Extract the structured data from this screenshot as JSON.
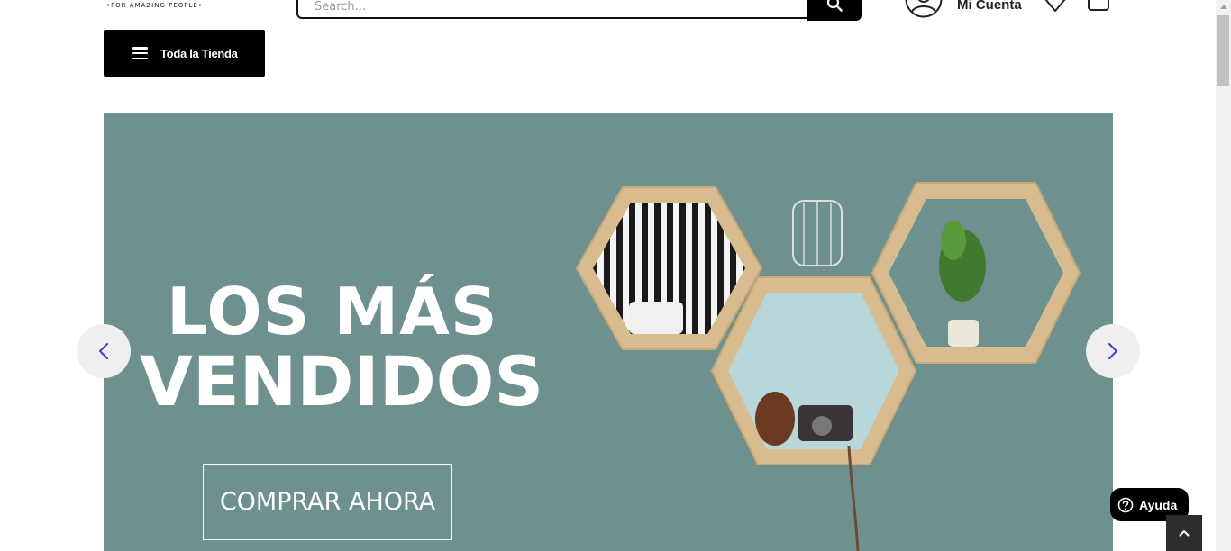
{
  "header": {
    "tagline": "•FOR AMAZING PEOPLE•",
    "search": {
      "placeholder": "Search..."
    },
    "account_label": "Mi Cuenta"
  },
  "categories_button": {
    "label": "Toda la Tienda"
  },
  "hero": {
    "headline_line1": "LOS MÁS",
    "headline_line2": "VENDIDOS",
    "cta_label": "COMPRAR AHORA",
    "background_color": "#6e9190"
  },
  "help_button": {
    "label": "Ayuda"
  },
  "icons": {
    "search": "search-icon",
    "account": "user-icon",
    "wishlist": "heart-icon",
    "cart": "cart-icon",
    "menu": "menu-icon",
    "prev": "chevron-left-icon",
    "next": "chevron-right-icon",
    "help": "question-icon",
    "top": "chevron-up-icon"
  },
  "colors": {
    "accent_arrow": "#3a3fd4",
    "button_bg": "#000000"
  }
}
